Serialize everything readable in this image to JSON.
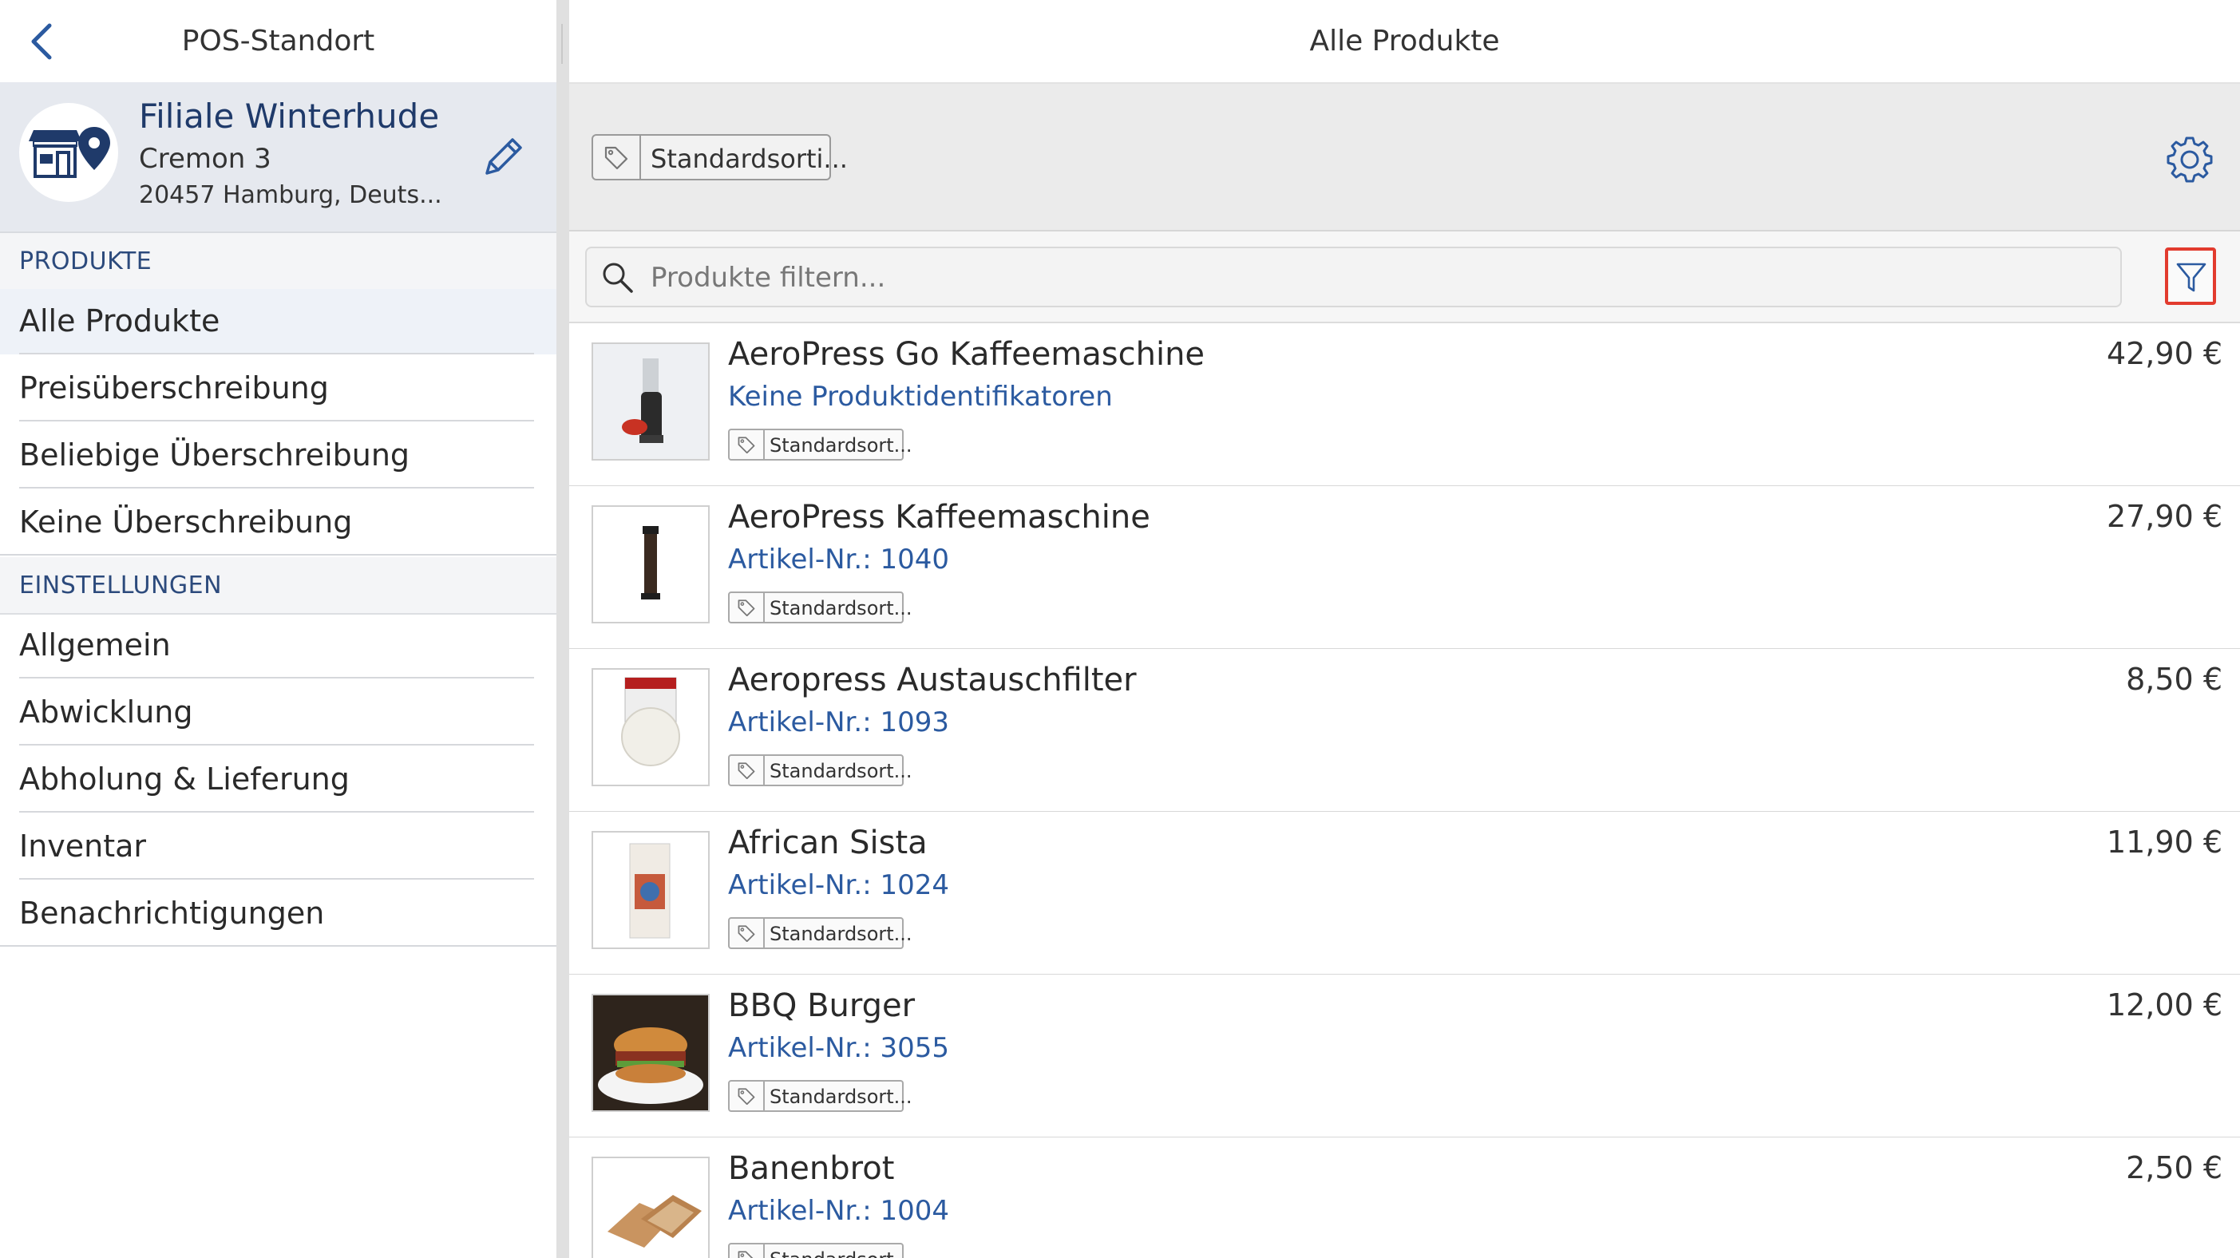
{
  "sidebar": {
    "title": "POS-Standort",
    "store": {
      "name": "Filiale Winterhude",
      "street": "Cremon 3",
      "city": "20457 Hamburg, Deuts..."
    },
    "sections": [
      {
        "header": "PRODUKTE",
        "items": [
          {
            "label": "Alle Produkte"
          },
          {
            "label": "Preisüberschreibung"
          },
          {
            "label": "Beliebige Überschreibung"
          },
          {
            "label": "Keine Überschreibung"
          }
        ]
      },
      {
        "header": "EINSTELLUNGEN",
        "items": [
          {
            "label": "Allgemein"
          },
          {
            "label": "Abwicklung"
          },
          {
            "label": "Abholung & Lieferung"
          },
          {
            "label": "Inventar"
          },
          {
            "label": "Benachrichtigungen"
          }
        ]
      }
    ]
  },
  "main": {
    "title": "Alle Produkte",
    "assortment_label": "Standardsorti...",
    "search": {
      "placeholder": "Produkte filtern...",
      "value": ""
    },
    "products": [
      {
        "name": "AeroPress Go Kaffeemaschine",
        "sub": "Keine Produktidentifikatoren",
        "tag": "Standardsort...",
        "price": "42,90 €"
      },
      {
        "name": "AeroPress Kaffeemaschine",
        "sub": "Artikel-Nr.: 1040",
        "tag": "Standardsort...",
        "price": "27,90 €"
      },
      {
        "name": "Aeropress Austauschfilter",
        "sub": "Artikel-Nr.: 1093",
        "tag": "Standardsort...",
        "price": "8,50 €"
      },
      {
        "name": "African Sista",
        "sub": "Artikel-Nr.: 1024",
        "tag": "Standardsort...",
        "price": "11,90 €"
      },
      {
        "name": "BBQ Burger",
        "sub": "Artikel-Nr.: 3055",
        "tag": "Standardsort...",
        "price": "12,00 €"
      },
      {
        "name": "Banenbrot",
        "sub": "Artikel-Nr.: 1004",
        "tag": "Standardsort...",
        "price": "2,50 €"
      }
    ]
  },
  "colors": {
    "accent_blue": "#2b5aa0",
    "store_name": "#1f3a6a",
    "filter_highlight": "#e23b2e"
  },
  "icons": [
    "back-arrow-icon",
    "store-location-icon",
    "pencil-icon",
    "tag-icon",
    "gear-icon",
    "search-icon",
    "filter-icon"
  ]
}
